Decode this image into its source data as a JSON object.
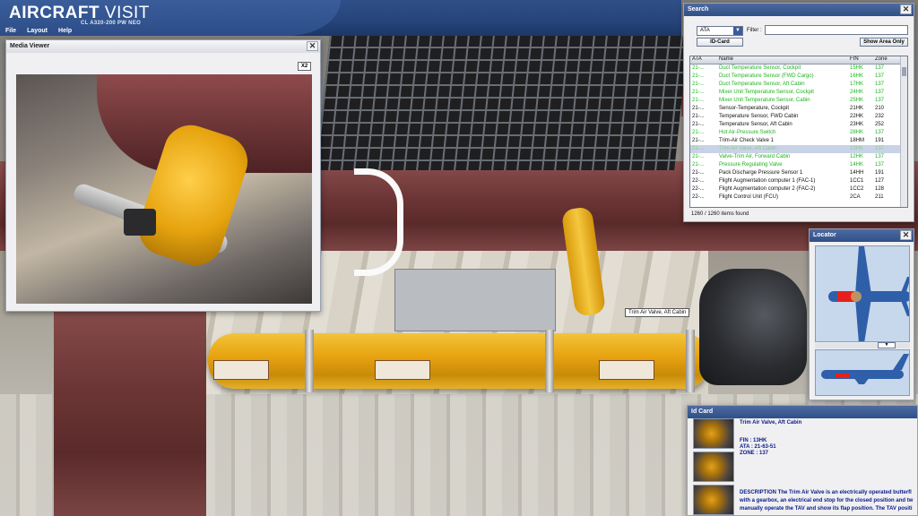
{
  "app": {
    "title_bold": "AIRCRAFT",
    "title_light": "VISIT",
    "subtitle": "CL A320-200 PW NEO",
    "menu": [
      "File",
      "Layout",
      "Help"
    ]
  },
  "media_viewer": {
    "title": "Media Viewer",
    "zoom_label": "X2",
    "close_label": "✕"
  },
  "search": {
    "title": "Search",
    "close_label": "✕",
    "ata_value": "ATA",
    "filter_label": "Filter :",
    "filter_value": "",
    "idcard_button": "ID-Card",
    "show_area_button": "Show Area Only",
    "columns": [
      "ATA",
      "Name",
      "FIN",
      "Zone"
    ],
    "rows": [
      {
        "ata": "21-...",
        "name": "Duct Temperature Sensor, Cockpit",
        "fin": "15HK",
        "zone": "137",
        "style": "green"
      },
      {
        "ata": "21-...",
        "name": "Duct Temperature Sensor (FWD Cargo)",
        "fin": "16HK",
        "zone": "137",
        "style": "green"
      },
      {
        "ata": "21-...",
        "name": "Duct Temperature Sensor, Aft Cabin",
        "fin": "17HK",
        "zone": "137",
        "style": "green"
      },
      {
        "ata": "21-...",
        "name": "Mixer Unit Temperature Sensor, Cockpit",
        "fin": "24HK",
        "zone": "137",
        "style": "green"
      },
      {
        "ata": "21-...",
        "name": "Mixer Unit Temperature Sensor, Cabin",
        "fin": "25HK",
        "zone": "137",
        "style": "green"
      },
      {
        "ata": "21-...",
        "name": "Sensor-Temperature, Cockpit",
        "fin": "21HK",
        "zone": "210",
        "style": "black"
      },
      {
        "ata": "21-...",
        "name": "Temperature Sensor, FWD Cabin",
        "fin": "22HK",
        "zone": "232",
        "style": "black"
      },
      {
        "ata": "21-...",
        "name": "Temperature Sensor, Aft Cabin",
        "fin": "23HK",
        "zone": "252",
        "style": "black"
      },
      {
        "ata": "21-...",
        "name": "Hot Air-Pressure Switch",
        "fin": "28HK",
        "zone": "137",
        "style": "green"
      },
      {
        "ata": "21-...",
        "name": "Trim-Air Check Valve 1",
        "fin": "18HM",
        "zone": "191",
        "style": "black"
      },
      {
        "ata": "21-...",
        "name": "Trim Air Valve, Aft Cabin",
        "fin": "13HK",
        "zone": "137",
        "style": "sel"
      },
      {
        "ata": "21-...",
        "name": "Valve-Trim Air, Forward Cabin",
        "fin": "12HK",
        "zone": "137",
        "style": "green"
      },
      {
        "ata": "21-...",
        "name": "Pressure Regulating Valve",
        "fin": "14HK",
        "zone": "137",
        "style": "green"
      },
      {
        "ata": "21-...",
        "name": "Pack Discharge Pressure Sensor 1",
        "fin": "14HH",
        "zone": "191",
        "style": "black"
      },
      {
        "ata": "22-...",
        "name": "Flight Augmentation computer 1 (FAC-1)",
        "fin": "1CC1",
        "zone": "127",
        "style": "black"
      },
      {
        "ata": "22-...",
        "name": "Flight Augmentation computer 2 (FAC-2)",
        "fin": "1CC2",
        "zone": "128",
        "style": "black"
      },
      {
        "ata": "22-...",
        "name": "Flight Control Unit (FCU)",
        "fin": "2CA",
        "zone": "211",
        "style": "black"
      }
    ],
    "result_count": "1260 / 1260 items found"
  },
  "locator": {
    "title": "Locator",
    "close_label": "✕"
  },
  "idcard": {
    "title": "Id Card",
    "part_name": "Trim Air Valve, Aft Cabin",
    "fin": "FIN : 13HK",
    "ata": "ATA : 21-63-51",
    "zone": "ZONE : 137",
    "description_lines": [
      "DESCRIPTION The Trim Air Valve is an electrically operated butterfl",
      "with a gearbox, an electrical end stop for the closed position and tw",
      "manually operate the TAV and show its flap position. The TAV positi"
    ]
  },
  "scene": {
    "tooltip": "Trim Air Valve, Aft Cabin"
  },
  "colors": {
    "header_blue": "#2f4f88",
    "row_green": "#1fb31f",
    "idcard_text": "#0a1a8a",
    "marker_red": "#e8201a"
  }
}
